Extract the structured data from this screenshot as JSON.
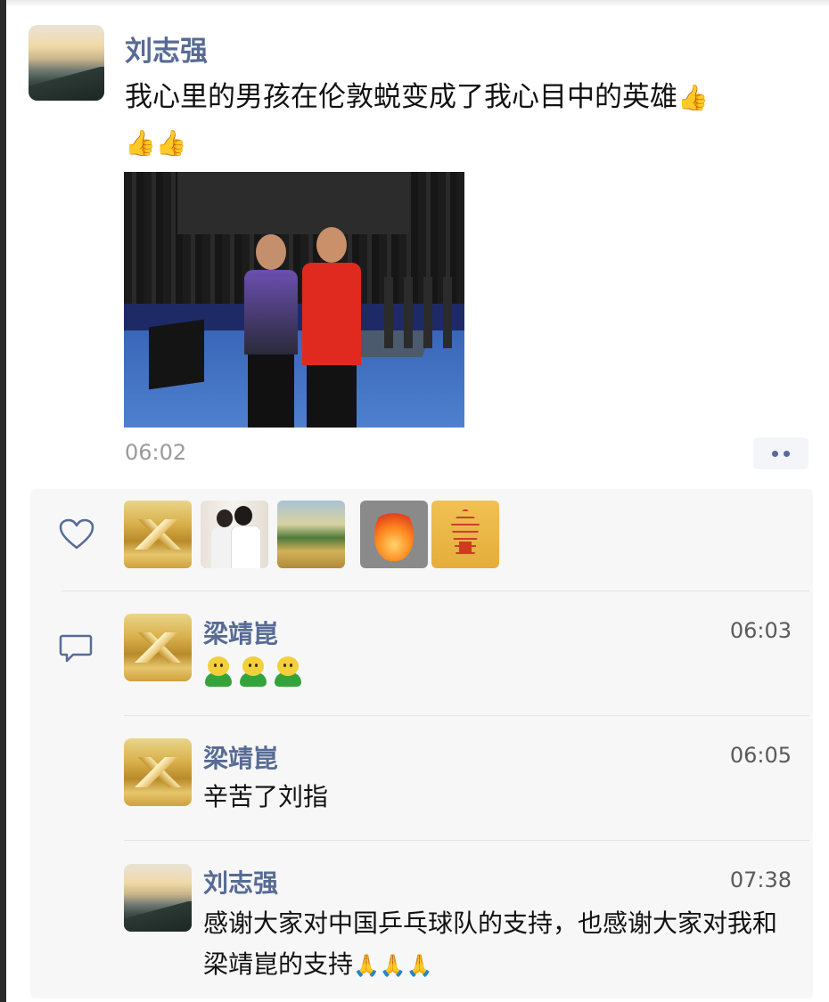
{
  "post": {
    "author": "刘志强",
    "text": "我心里的男孩在伦敦蜕变成了我心目中的英雄",
    "thumbs_emoji": "👍",
    "time": "06:02"
  },
  "likes": {
    "count_visible": 5
  },
  "comments": [
    {
      "name": "梁靖崑",
      "time": "06:03",
      "text": ""
    },
    {
      "name": "梁靖崑",
      "time": "06:05",
      "text": "辛苦了刘指"
    },
    {
      "name": "刘志强",
      "time": "07:38",
      "text": "感谢大家对中国乒乓球队的支持，也感谢大家对我和梁靖崑的支持"
    }
  ],
  "emoji": {
    "bow": "🙏"
  },
  "colors": {
    "name_link": "#576b95",
    "time_gray": "#9a9a9a",
    "panel_bg": "#f7f7f7"
  }
}
